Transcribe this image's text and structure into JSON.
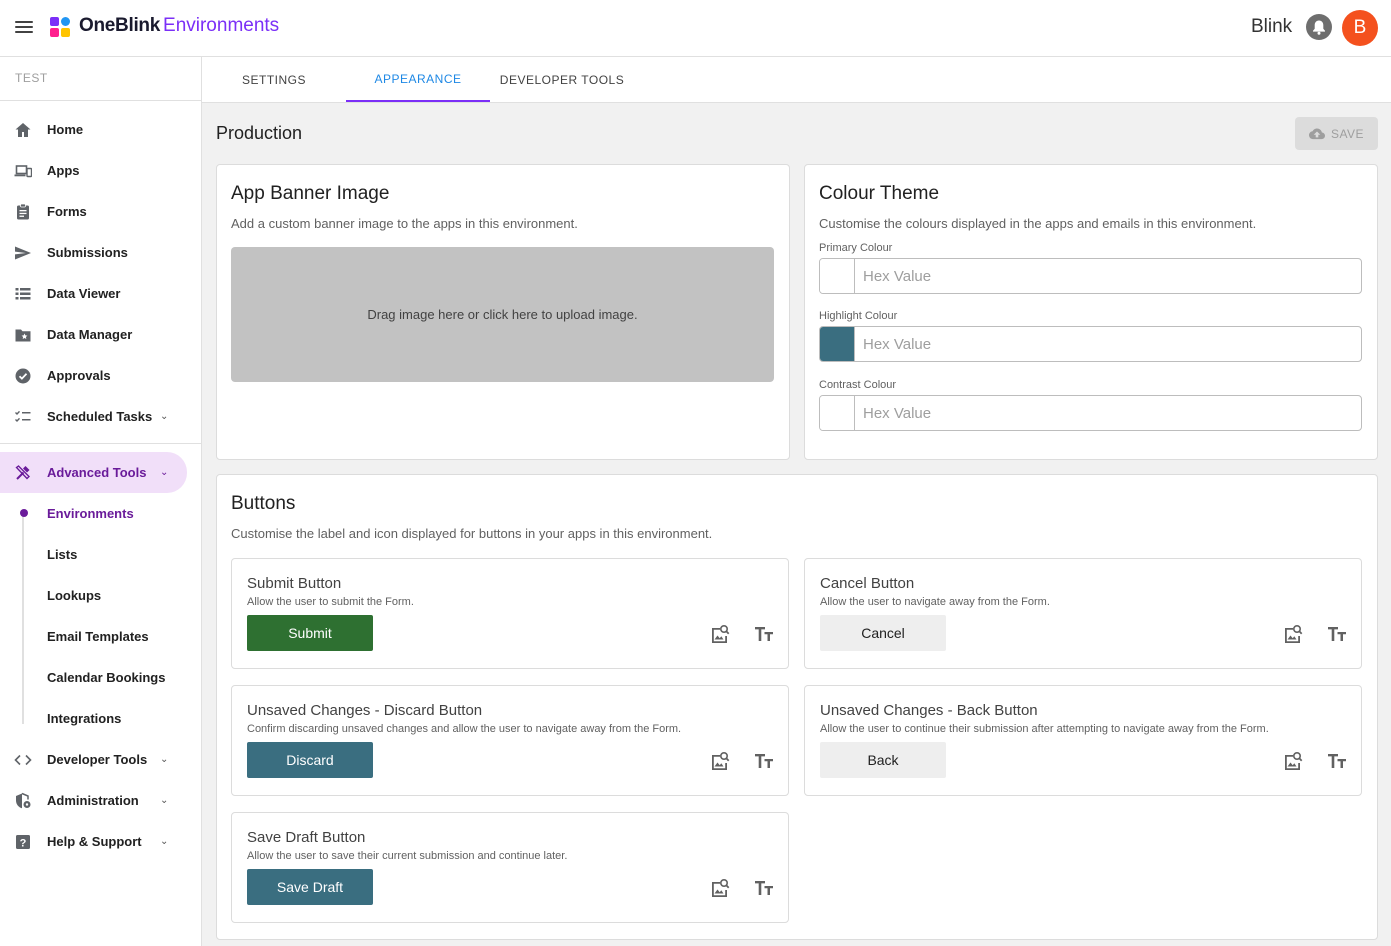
{
  "app": {
    "brand_bold": "OneBlink",
    "brand_product": "Environments",
    "org_name": "Blink",
    "avatar_initial": "B"
  },
  "sidebar": {
    "env_label": "TEST",
    "items": [
      {
        "label": "Home",
        "icon": "home-icon"
      },
      {
        "label": "Apps",
        "icon": "devices-icon"
      },
      {
        "label": "Forms",
        "icon": "clipboard-icon"
      },
      {
        "label": "Submissions",
        "icon": "send-icon"
      },
      {
        "label": "Data Viewer",
        "icon": "list-icon"
      },
      {
        "label": "Data Manager",
        "icon": "folder-star-icon"
      },
      {
        "label": "Approvals",
        "icon": "check-circle-icon"
      },
      {
        "label": "Scheduled Tasks",
        "icon": "checklist-icon"
      }
    ],
    "advanced_tools": {
      "label": "Advanced Tools",
      "icon": "tools-icon",
      "children": [
        "Environments",
        "Lists",
        "Lookups",
        "Email Templates",
        "Calendar Bookings",
        "Integrations"
      ]
    },
    "bottom_items": [
      {
        "label": "Developer Tools",
        "icon": "code-icon"
      },
      {
        "label": "Administration",
        "icon": "admin-shield-icon"
      },
      {
        "label": "Help & Support",
        "icon": "help-icon"
      }
    ]
  },
  "tabs": [
    "SETTINGS",
    "APPEARANCE",
    "DEVELOPER TOOLS"
  ],
  "active_tab": "APPEARANCE",
  "page": {
    "title": "Production",
    "save_label": "SAVE"
  },
  "banner": {
    "title": "App Banner Image",
    "description": "Add a custom banner image to the apps in this environment.",
    "dropzone_text": "Drag image here or click here to upload image."
  },
  "colour_theme": {
    "title": "Colour Theme",
    "description": "Customise the colours displayed in the apps and emails in this environment.",
    "fields": [
      {
        "label": "Primary Colour",
        "placeholder": "Hex Value",
        "swatch": "#ffffff"
      },
      {
        "label": "Highlight Colour",
        "placeholder": "Hex Value",
        "swatch": "#3a6e80"
      },
      {
        "label": "Contrast Colour",
        "placeholder": "Hex Value",
        "swatch": "#ffffff"
      }
    ]
  },
  "buttons": {
    "title": "Buttons",
    "description": "Customise the label and icon displayed for buttons in your apps in this environment.",
    "cards": [
      {
        "title": "Submit Button",
        "description": "Allow the user to submit the Form.",
        "label": "Submit",
        "bg": "#2e7031",
        "fg": "#ffffff"
      },
      {
        "title": "Cancel Button",
        "description": "Allow the user to navigate away from the Form.",
        "label": "Cancel",
        "bg": "#eeeeee",
        "fg": "#212121"
      },
      {
        "title": "Unsaved Changes - Discard Button",
        "description": "Confirm discarding unsaved changes and allow the user to navigate away from the Form.",
        "label": "Discard",
        "bg": "#3a6e80",
        "fg": "#ffffff"
      },
      {
        "title": "Unsaved Changes - Back Button",
        "description": "Allow the user to continue their submission after attempting to navigate away from the Form.",
        "label": "Back",
        "bg": "#eeeeee",
        "fg": "#212121"
      },
      {
        "title": "Save Draft Button",
        "description": "Allow the user to save their current submission and continue later.",
        "label": "Save Draft",
        "bg": "#3a6e80",
        "fg": "#ffffff"
      }
    ]
  }
}
